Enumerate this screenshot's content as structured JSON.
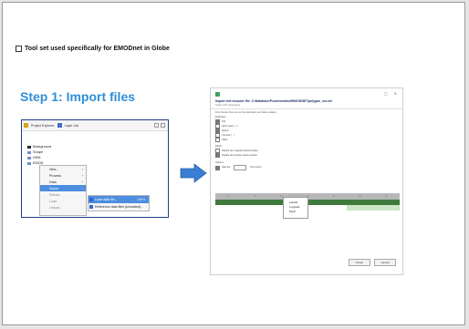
{
  "slide": {
    "bullet": "Tool set used specifically for EMODnet in Globe",
    "step_title": "Step 1: Import files"
  },
  "explorer": {
    "tabs": [
      "Project Explorer",
      "Layer List"
    ],
    "tree": [
      "Background",
      "Shape",
      "DEM",
      "EMOD"
    ],
    "context_menu": [
      "New...",
      "Process",
      "Data",
      "Import",
      "Reload",
      "Load",
      "Unload"
    ],
    "submenu": {
      "item1": "Load data file...",
      "item1_shortcut": "Ctrl+I",
      "item2": "Reference data files (unloaded)..."
    }
  },
  "dialog": {
    "title": "Import text encoder file: Z:\\Database\\Pcon\\emodnet\\EMODNET\\polygon_xxx.txt",
    "subtitle": "Select CSV parameters",
    "hint": "First choose how you set the delimiters your data contains",
    "delimiters_label": "Delimiters",
    "delimiters": [
      {
        "label": "Tab",
        "checked": true
      },
      {
        "label": "Semi-colon ( ; )",
        "checked": false
      },
      {
        "label": "Space",
        "checked": true
      },
      {
        "label": "Comma ( , )",
        "checked": false
      },
      {
        "label": "Other",
        "checked": false
      }
    ],
    "depth_label": "Depth",
    "depth_options": [
      "Depths are negative below surface",
      "Depths are positive below surface"
    ],
    "options_label": "Options",
    "skip_label": "Skip the",
    "skip_unit": "first row(s)",
    "column_headers": [
      "<>",
      "<>",
      "<>",
      "<>",
      "<>",
      "<>",
      "<>"
    ],
    "column_menu": [
      "Latitude",
      "Longitude",
      "Depth"
    ],
    "rows": [
      [
        "",
        "",
        "",
        "",
        "",
        "",
        ""
      ],
      [
        "",
        "",
        "",
        "",
        "",
        "",
        ""
      ],
      [
        "",
        "",
        "",
        "",
        "",
        "",
        ""
      ],
      [
        "",
        "",
        "",
        "",
        "",
        "",
        ""
      ],
      [
        "",
        "",
        "",
        "",
        "",
        "",
        ""
      ],
      [
        "",
        "",
        "",
        "",
        "",
        "",
        ""
      ],
      [
        "",
        "",
        "",
        "",
        "",
        "",
        ""
      ],
      [
        "",
        "",
        "",
        "",
        "",
        "",
        ""
      ],
      [
        "",
        "",
        "",
        "",
        "",
        "",
        ""
      ]
    ],
    "warning": "",
    "buttons": {
      "finish": "Finish",
      "cancel": "Cancel"
    }
  }
}
